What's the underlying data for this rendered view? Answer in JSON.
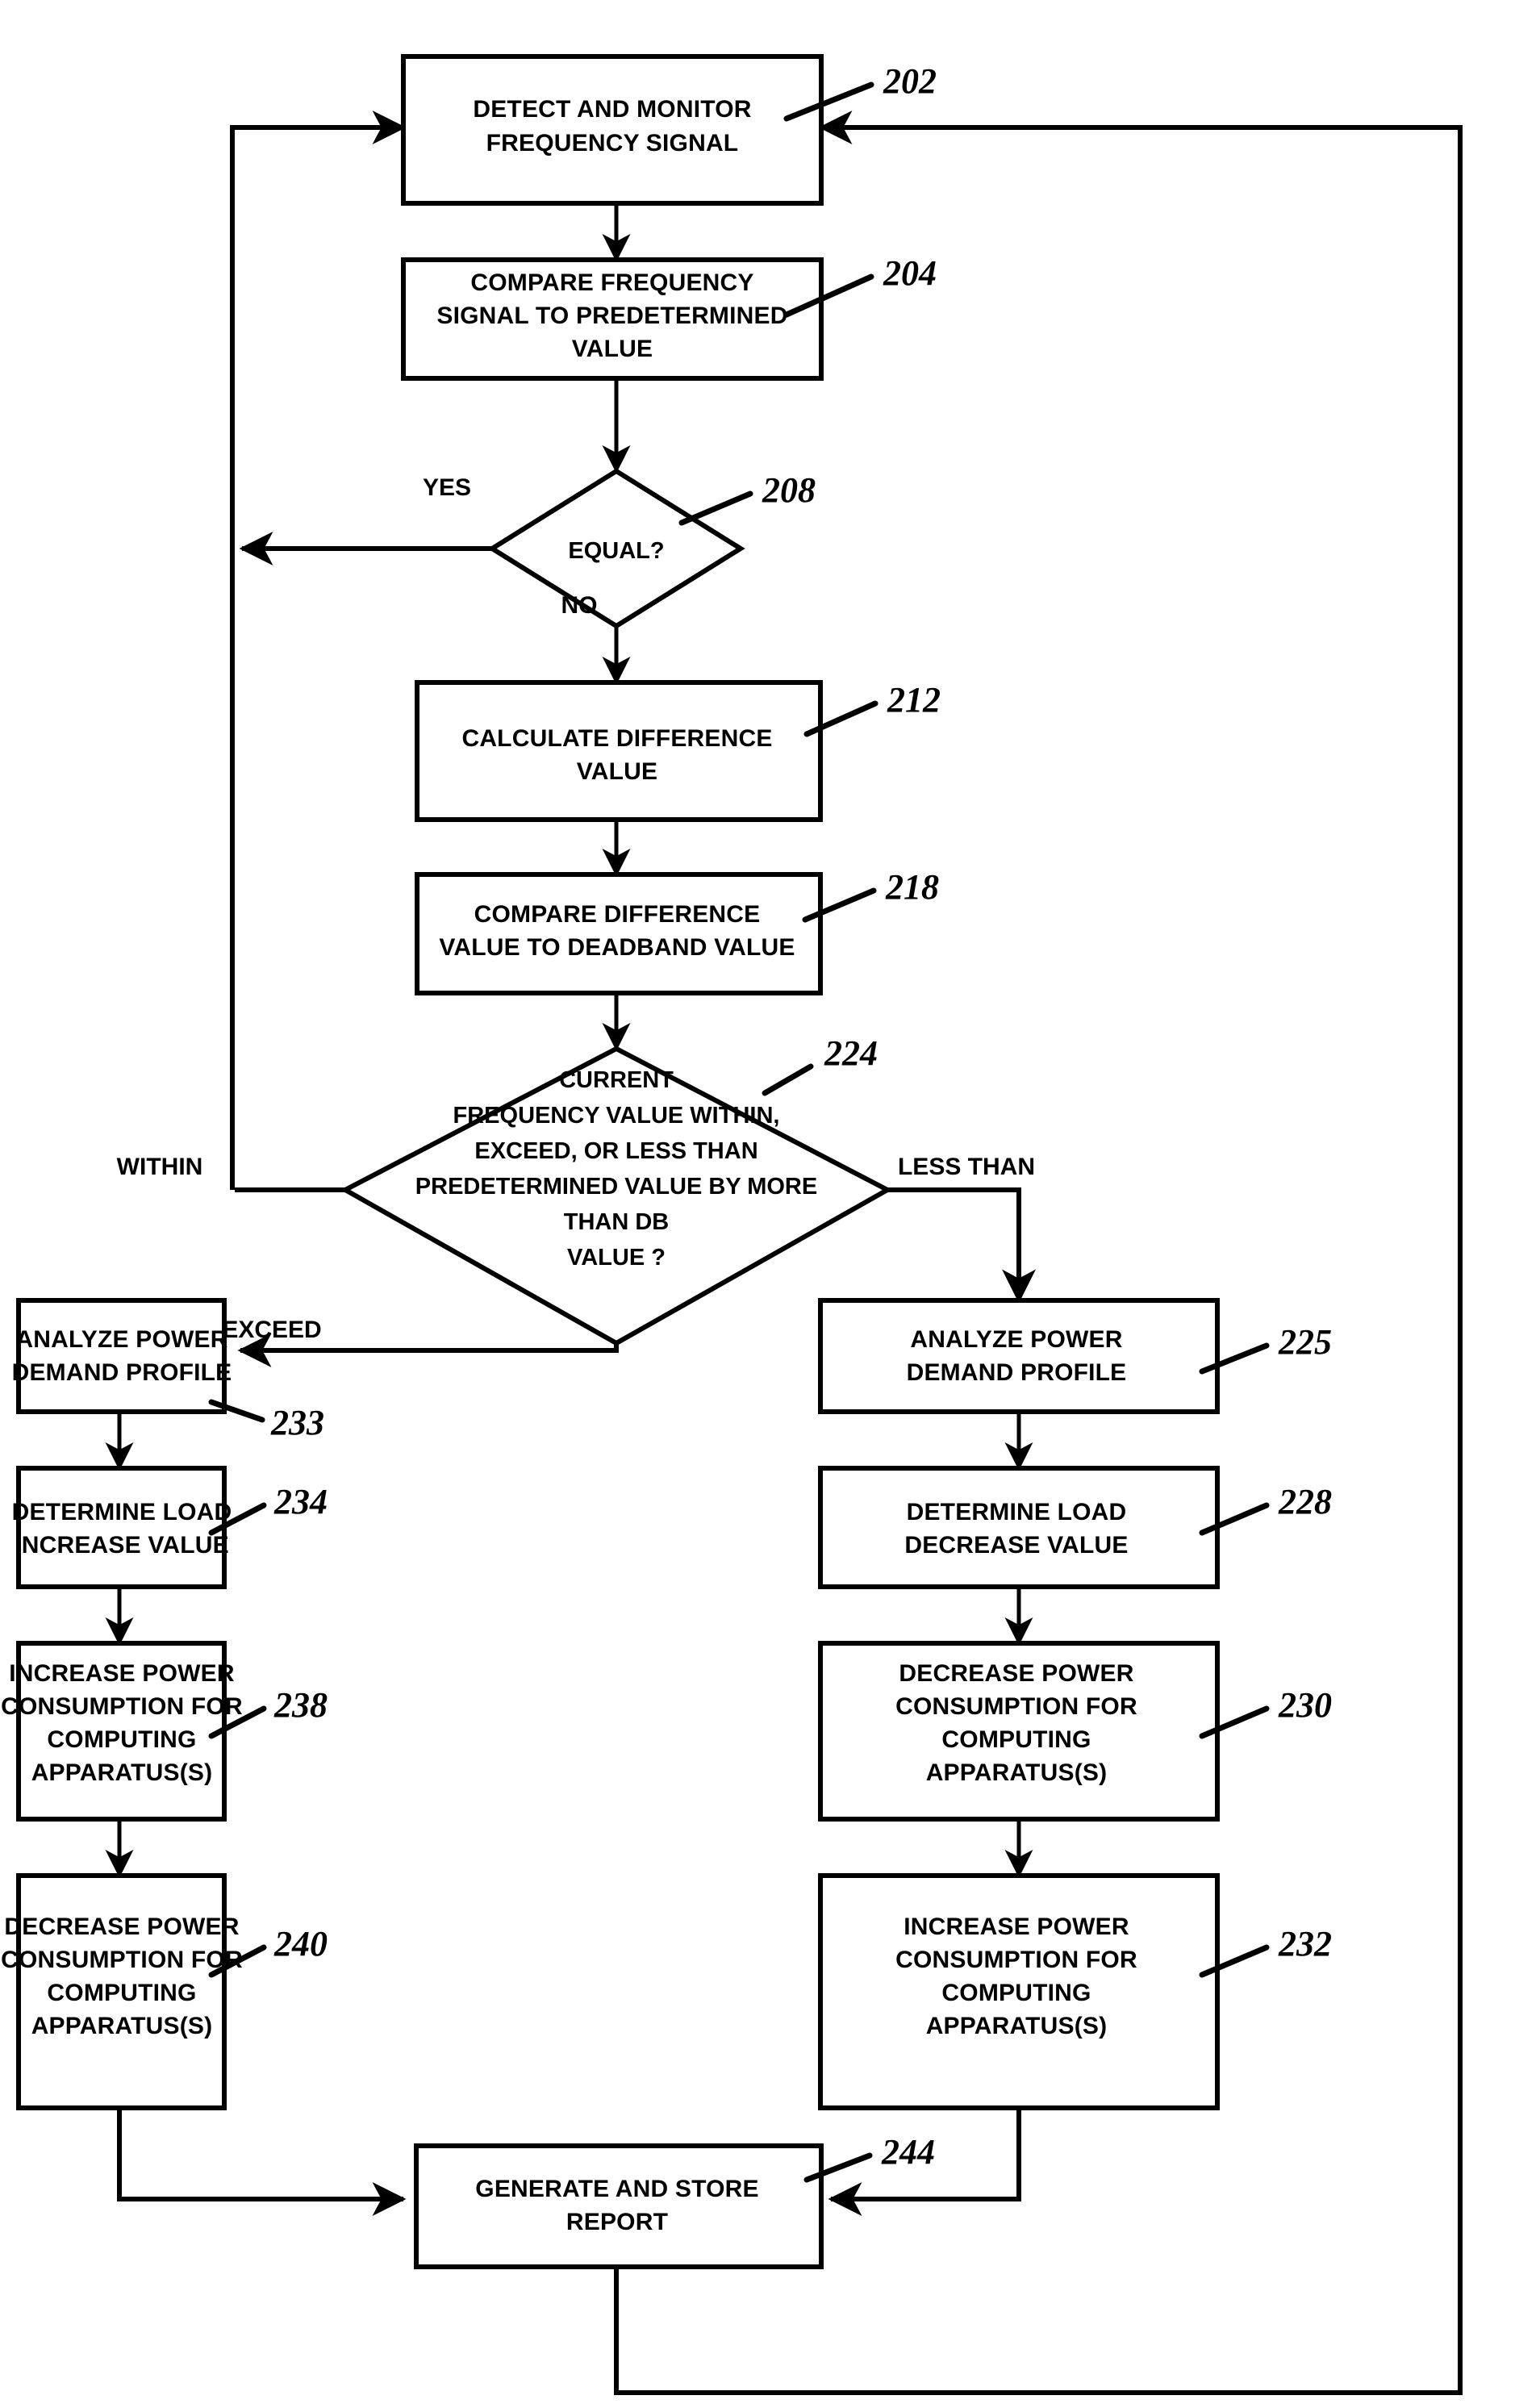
{
  "figure": {
    "type": "process-flowchart",
    "background": "#ffffff",
    "line_color": "#000000"
  },
  "nodes": [
    {
      "id": "n202",
      "ref": "202",
      "shape": "process",
      "lines": [
        "DETECT AND MONITOR",
        "FREQUENCY SIGNAL"
      ]
    },
    {
      "id": "n204",
      "ref": "204",
      "shape": "process",
      "lines": [
        "COMPARE FREQUENCY",
        "SIGNAL TO PREDETERMINED",
        "VALUE"
      ]
    },
    {
      "id": "n208",
      "ref": "208",
      "shape": "decision",
      "lines": [
        "EQUAL?"
      ]
    },
    {
      "id": "n212",
      "ref": "212",
      "shape": "process",
      "lines": [
        "CALCULATE DIFFERENCE",
        "VALUE"
      ]
    },
    {
      "id": "n218",
      "ref": "218",
      "shape": "process",
      "lines": [
        "COMPARE DIFFERENCE",
        "VALUE TO DEADBAND VALUE"
      ]
    },
    {
      "id": "n224",
      "ref": "224",
      "shape": "decision",
      "lines": [
        "CURRENT",
        "FREQUENCY VALUE WITHIN,",
        "EXCEED, OR LESS THAN",
        "PREDETERMINED VALUE BY MORE",
        "THAN DB",
        "VALUE ?"
      ]
    },
    {
      "id": "n233",
      "ref": "233",
      "shape": "process",
      "lines": [
        "ANALYZE POWER",
        "DEMAND PROFILE"
      ]
    },
    {
      "id": "n234",
      "ref": "234",
      "shape": "process",
      "lines": [
        "DETERMINE LOAD",
        "INCREASE VALUE"
      ]
    },
    {
      "id": "n238",
      "ref": "238",
      "shape": "process",
      "lines": [
        "INCREASE POWER",
        "CONSUMPTION FOR",
        "COMPUTING",
        "APPARATUS(S)"
      ]
    },
    {
      "id": "n240",
      "ref": "240",
      "shape": "process",
      "lines": [
        "DECREASE POWER",
        "CONSUMPTION FOR",
        "COMPUTING",
        "APPARATUS(S)"
      ]
    },
    {
      "id": "n225",
      "ref": "225",
      "shape": "process",
      "lines": [
        "ANALYZE POWER",
        "DEMAND PROFILE"
      ]
    },
    {
      "id": "n228",
      "ref": "228",
      "shape": "process",
      "lines": [
        "DETERMINE LOAD",
        "DECREASE VALUE"
      ]
    },
    {
      "id": "n230",
      "ref": "230",
      "shape": "process",
      "lines": [
        "DECREASE POWER",
        "CONSUMPTION FOR",
        "COMPUTING",
        "APPARATUS(S)"
      ]
    },
    {
      "id": "n232",
      "ref": "232",
      "shape": "process",
      "lines": [
        "INCREASE POWER",
        "CONSUMPTION FOR",
        "COMPUTING",
        "APPARATUS(S)"
      ]
    },
    {
      "id": "n244",
      "ref": "244",
      "shape": "process",
      "lines": [
        "GENERATE AND STORE",
        "REPORT"
      ]
    }
  ],
  "edge_labels": {
    "yes": "YES",
    "no": "NO",
    "within": "WITHIN",
    "exceed": "EXCEED",
    "less_than": "LESS THAN"
  },
  "reference_numerals": {
    "r202": "202",
    "r204": "204",
    "r208": "208",
    "r212": "212",
    "r218": "218",
    "r224": "224",
    "r225": "225",
    "r228": "228",
    "r230": "230",
    "r232": "232",
    "r233": "233",
    "r234": "234",
    "r238": "238",
    "r240": "240",
    "r244": "244"
  },
  "text": {
    "n202_l0": "DETECT AND MONITOR",
    "n202_l1": "FREQUENCY SIGNAL",
    "n204_l0": "COMPARE FREQUENCY",
    "n204_l1": "SIGNAL TO PREDETERMINED",
    "n204_l2": "VALUE",
    "n208_l0": "EQUAL?",
    "n212_l0": "CALCULATE DIFFERENCE",
    "n212_l1": "VALUE",
    "n218_l0": "COMPARE DIFFERENCE",
    "n218_l1": "VALUE TO DEADBAND VALUE",
    "n224_l0": "CURRENT",
    "n224_l1": "FREQUENCY VALUE WITHIN,",
    "n224_l2": "EXCEED, OR LESS THAN",
    "n224_l3": "PREDETERMINED VALUE BY MORE",
    "n224_l4": "THAN DB",
    "n224_l5": "VALUE ?",
    "n233_l0": "ANALYZE POWER",
    "n233_l1": "DEMAND PROFILE",
    "n234_l0": "DETERMINE LOAD",
    "n234_l1": "INCREASE VALUE",
    "n238_l0": "INCREASE POWER",
    "n238_l1": "CONSUMPTION FOR",
    "n238_l2": "COMPUTING",
    "n238_l3": "APPARATUS(S)",
    "n240_l0": "DECREASE POWER",
    "n240_l1": "CONSUMPTION FOR",
    "n240_l2": "COMPUTING",
    "n240_l3": "APPARATUS(S)",
    "n225_l0": "ANALYZE POWER",
    "n225_l1": "DEMAND PROFILE",
    "n228_l0": "DETERMINE LOAD",
    "n228_l1": "DECREASE VALUE",
    "n230_l0": "DECREASE POWER",
    "n230_l1": "CONSUMPTION FOR",
    "n230_l2": "COMPUTING",
    "n230_l3": "APPARATUS(S)",
    "n232_l0": "INCREASE POWER",
    "n232_l1": "CONSUMPTION FOR",
    "n232_l2": "COMPUTING",
    "n232_l3": "APPARATUS(S)",
    "n244_l0": "GENERATE AND STORE",
    "n244_l1": "REPORT"
  }
}
